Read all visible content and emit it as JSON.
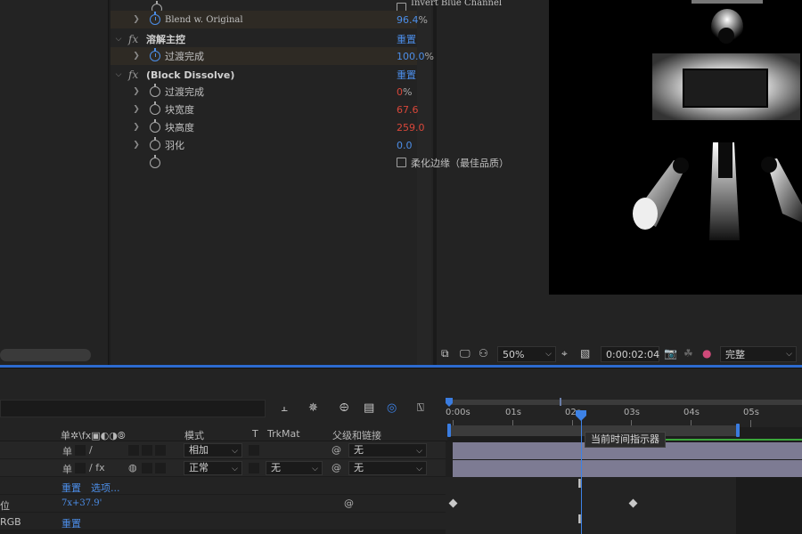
{
  "effects": {
    "top_row": {
      "label": "Invert Blue Channel"
    },
    "rows": [
      {
        "kind": "prop",
        "label": "Blend w. Original",
        "value": "96.4",
        "unit": "%",
        "value_color": "blue",
        "stopwatch": "on",
        "highlight": true
      },
      {
        "kind": "effect",
        "label": "溶解主控",
        "reset": "重置"
      },
      {
        "kind": "prop",
        "label": "过渡完成",
        "value": "100.0",
        "unit": "%",
        "value_color": "blue",
        "stopwatch": "on",
        "highlight": true
      },
      {
        "kind": "effect",
        "label": "(Block Dissolve)",
        "reset": "重置"
      },
      {
        "kind": "prop",
        "label": "过渡完成",
        "value": "0",
        "unit": "%",
        "value_color": "red",
        "stopwatch": "off"
      },
      {
        "kind": "prop",
        "label": "块宽度",
        "value": "67.6",
        "unit": "",
        "value_color": "red",
        "stopwatch": "off"
      },
      {
        "kind": "prop",
        "label": "块高度",
        "value": "259.0",
        "unit": "",
        "value_color": "red",
        "stopwatch": "off"
      },
      {
        "kind": "prop",
        "label": "羽化",
        "value": "0.0",
        "unit": "",
        "value_color": "blue",
        "stopwatch": "off"
      },
      {
        "kind": "checkbox",
        "label": "柔化边缘（最佳品质）"
      }
    ]
  },
  "comp_toolbar": {
    "zoom": "50%",
    "timecode": "0:00:02:04",
    "resolution": "完整",
    "icons": [
      "always-preview-icon",
      "monitor-icon",
      "mask-icon",
      "grid-icon",
      "region-icon",
      "camera-icon",
      "channel-icon",
      "color-icon"
    ]
  },
  "timeline": {
    "ruler_labels": [
      "0:00s",
      "01s",
      "02s",
      "03s",
      "04s",
      "05s"
    ],
    "columns": {
      "switches": "单✲\\fx▣◐◑⦾",
      "mode": "模式",
      "t": "T",
      "trkmat": "TrkMat",
      "parent": "父级和链接"
    },
    "layers": [
      {
        "mode": "相加",
        "trkmat": "",
        "parent": "无",
        "switch_slash": "/"
      },
      {
        "mode": "正常",
        "trkmat": "无",
        "parent": "无",
        "switch_slash": "/ fx"
      }
    ],
    "sub_row": {
      "reset": "重置",
      "options": "选项..."
    },
    "position_row": {
      "label": "位",
      "value": "7x+37.9'"
    },
    "rgb_row": {
      "label": "RGB",
      "reset": "重置"
    },
    "tooltip": "当前时间指示器",
    "colors": {
      "accent": "#3d82e6",
      "track": "#7d7b93",
      "green": "#3aa63a",
      "red_value": "#d9473a"
    }
  }
}
